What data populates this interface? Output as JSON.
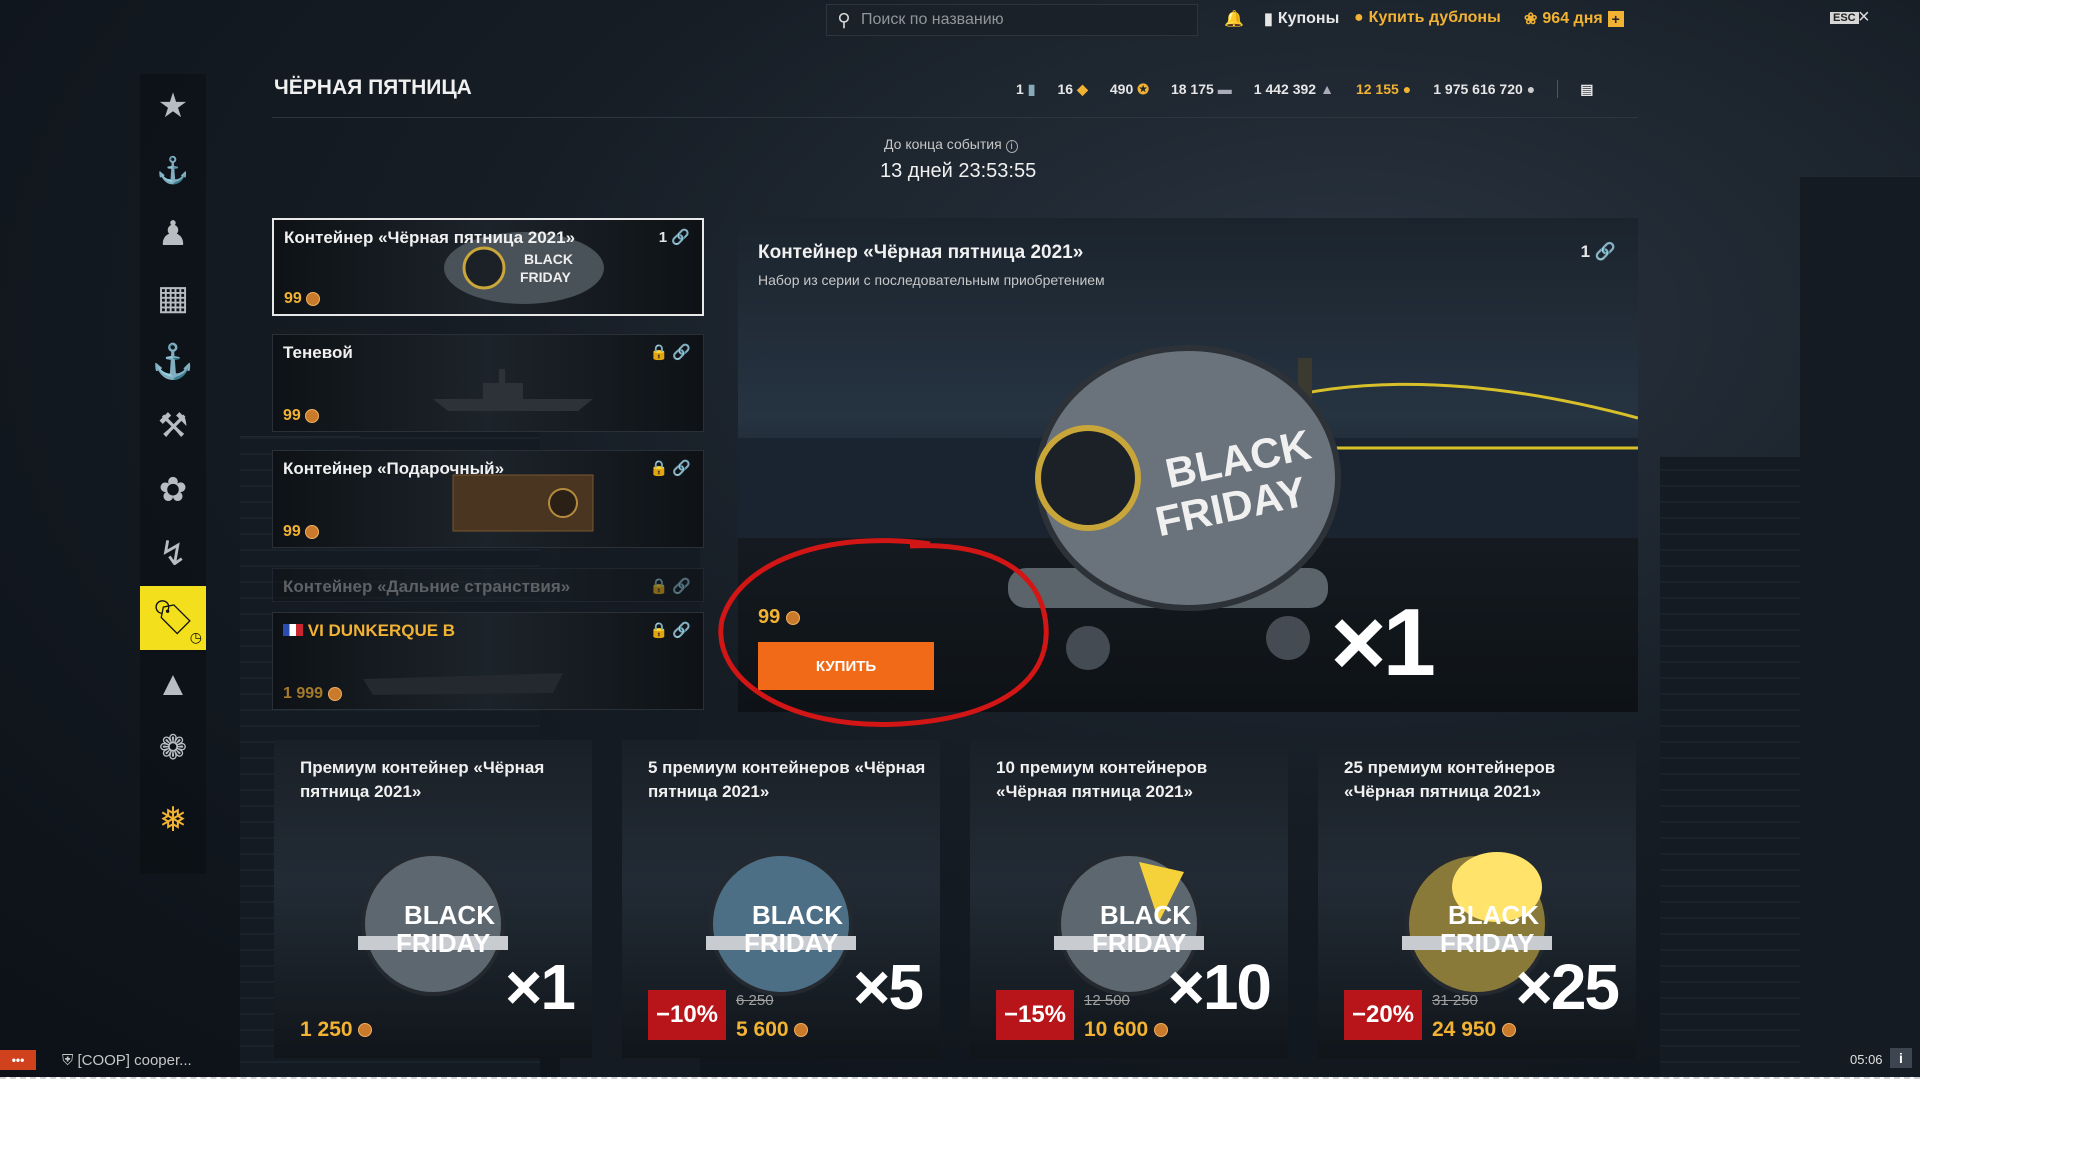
{
  "search": {
    "placeholder": "Поиск по названию"
  },
  "topbar": {
    "coupons": "Купоны",
    "buy_doubloons": "Купить дублоны",
    "premium_days": "964 дня",
    "esc": "ESC"
  },
  "page_title": "ЧЁРНАЯ ПЯТНИЦА",
  "resources": [
    "1",
    "16",
    "490",
    "18 175",
    "1 442 392",
    "12 155",
    "1 975 616 720"
  ],
  "event": {
    "label": "До конца события",
    "remaining": "13 дней 23:53:55"
  },
  "bundles": [
    {
      "name": "Контейнер «Чёрная пятница 2021»",
      "count": "1",
      "price": "99"
    },
    {
      "name": "Теневой",
      "price": "99"
    },
    {
      "name": "Контейнер «Подарочный»",
      "price": "99"
    },
    {
      "name": "Контейнер «Дальние странствия»"
    },
    {
      "name": "VI DUNKERQUE B",
      "price": "1 999"
    }
  ],
  "hero": {
    "title": "Контейнер «Чёрная пятница 2021»",
    "subtitle": "Набор из серии с последовательным приобретением",
    "count": "1",
    "price": "99",
    "buy_label": "КУПИТЬ",
    "multiplier": "×1",
    "container_text_1": "BLACK",
    "container_text_2": "FRIDAY"
  },
  "offers": [
    {
      "title": "Премиум контейнер «Чёрная пятница 2021»",
      "multiplier": "×1",
      "price": "1 250"
    },
    {
      "title": "5 премиум контейнеров «Чёрная пятница 2021»",
      "multiplier": "×5",
      "discount": "−10%",
      "old_price": "6 250",
      "price": "5 600"
    },
    {
      "title": "10 премиум контейнеров «Чёрная пятница 2021»",
      "multiplier": "×10",
      "discount": "−15%",
      "old_price": "12 500",
      "price": "10 600"
    },
    {
      "title": "25 премиум контейнеров «Чёрная пятница 2021»",
      "multiplier": "×25",
      "discount": "−20%",
      "old_price": "31 250",
      "price": "24 950"
    }
  ],
  "offer_art": {
    "line1": "BLACK",
    "line2": "FRIDAY"
  },
  "chat": {
    "button": "•••",
    "text": "[COOP] cooper..."
  },
  "status": {
    "clock": "05:06",
    "info": "i"
  },
  "colors": {
    "accent_buy": "#f06a17",
    "gold": "#f2b233",
    "discount": "#b8151b",
    "active_tab": "#f3df1b"
  }
}
